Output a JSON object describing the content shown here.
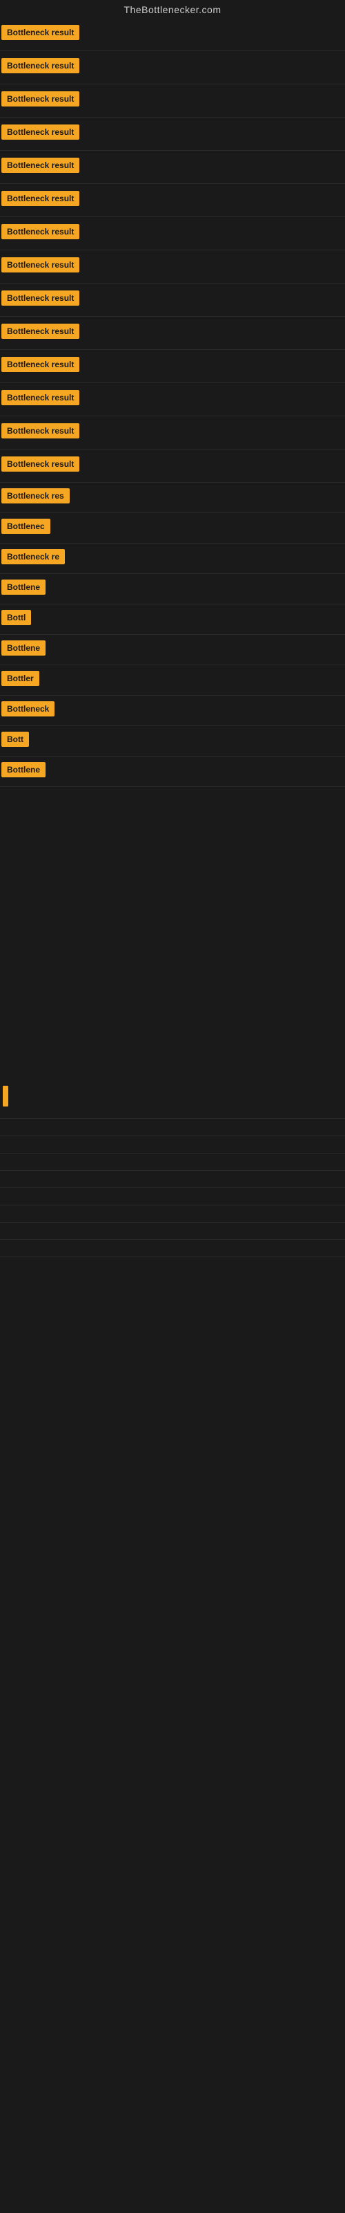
{
  "site": {
    "title": "TheBottlenecker.com"
  },
  "rows": [
    {
      "id": 1,
      "label": "Bottleneck result",
      "badgeClass": "badge-full",
      "padding": "row"
    },
    {
      "id": 2,
      "label": "Bottleneck result",
      "badgeClass": "badge-full",
      "padding": "row"
    },
    {
      "id": 3,
      "label": "Bottleneck result",
      "badgeClass": "badge-full",
      "padding": "row"
    },
    {
      "id": 4,
      "label": "Bottleneck result",
      "badgeClass": "badge-full",
      "padding": "row"
    },
    {
      "id": 5,
      "label": "Bottleneck result",
      "badgeClass": "badge-full",
      "padding": "row"
    },
    {
      "id": 6,
      "label": "Bottleneck result",
      "badgeClass": "badge-full",
      "padding": "row"
    },
    {
      "id": 7,
      "label": "Bottleneck result",
      "badgeClass": "badge-full",
      "padding": "row"
    },
    {
      "id": 8,
      "label": "Bottleneck result",
      "badgeClass": "badge-full",
      "padding": "row"
    },
    {
      "id": 9,
      "label": "Bottleneck result",
      "badgeClass": "badge-full",
      "padding": "row"
    },
    {
      "id": 10,
      "label": "Bottleneck result",
      "badgeClass": "badge-full",
      "padding": "row"
    },
    {
      "id": 11,
      "label": "Bottleneck result",
      "badgeClass": "badge-full",
      "padding": "row"
    },
    {
      "id": 12,
      "label": "Bottleneck result",
      "badgeClass": "badge-full",
      "padding": "row"
    },
    {
      "id": 13,
      "label": "Bottleneck result",
      "badgeClass": "badge-full",
      "padding": "row"
    },
    {
      "id": 14,
      "label": "Bottleneck result",
      "badgeClass": "badge-full",
      "padding": "row"
    },
    {
      "id": 15,
      "label": "Bottleneck res",
      "badgeClass": "badge-med1",
      "padding": "row-small"
    },
    {
      "id": 16,
      "label": "Bottlenec",
      "badgeClass": "badge-med3",
      "padding": "row-small"
    },
    {
      "id": 17,
      "label": "Bottleneck re",
      "badgeClass": "badge-med2",
      "padding": "row-small"
    },
    {
      "id": 18,
      "label": "Bottlene",
      "badgeClass": "badge-med4",
      "padding": "row-small"
    },
    {
      "id": 19,
      "label": "Bottl",
      "badgeClass": "badge-med6",
      "padding": "row-small"
    },
    {
      "id": 20,
      "label": "Bottlene",
      "badgeClass": "badge-med4",
      "padding": "row-small"
    },
    {
      "id": 21,
      "label": "Bottler",
      "badgeClass": "badge-med5",
      "padding": "row-small"
    },
    {
      "id": 22,
      "label": "Bottleneck",
      "badgeClass": "badge-med3",
      "padding": "row-small"
    },
    {
      "id": 23,
      "label": "Bott",
      "badgeClass": "badge-med7",
      "padding": "row-small"
    },
    {
      "id": 24,
      "label": "Bottlene",
      "badgeClass": "badge-med4",
      "padding": "row-small"
    }
  ],
  "colors": {
    "badge_bg": "#f5a623",
    "badge_text": "#1a1a1a",
    "background": "#1a1a1a",
    "title_text": "#cccccc"
  }
}
